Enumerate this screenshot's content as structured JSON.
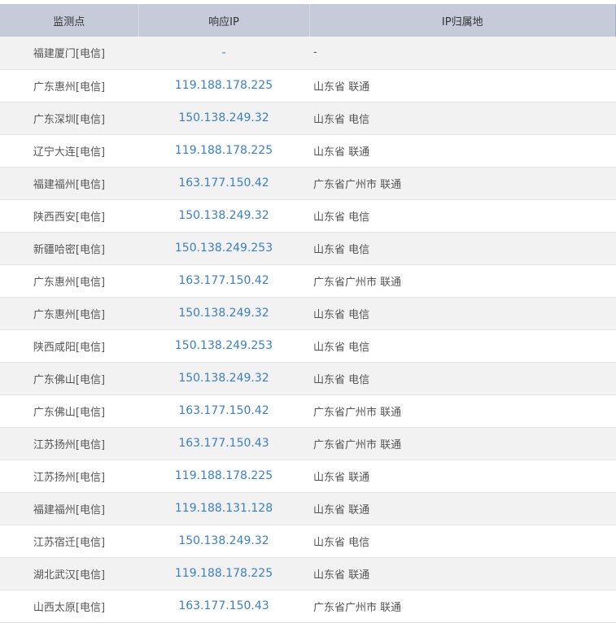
{
  "table": {
    "headers": [
      "监测点",
      "响应IP",
      "IP归属地"
    ],
    "rows": [
      {
        "point": "福建厦门[电信]",
        "ip": "-",
        "location": "-"
      },
      {
        "point": "广东惠州[电信]",
        "ip": "119.188.178.225",
        "location": "山东省 联通"
      },
      {
        "point": "广东深圳[电信]",
        "ip": "150.138.249.32",
        "location": "山东省 电信"
      },
      {
        "point": "辽宁大连[电信]",
        "ip": "119.188.178.225",
        "location": "山东省 联通"
      },
      {
        "point": "福建福州[电信]",
        "ip": "163.177.150.42",
        "location": "广东省广州市 联通"
      },
      {
        "point": "陕西西安[电信]",
        "ip": "150.138.249.32",
        "location": "山东省 电信"
      },
      {
        "point": "新疆哈密[电信]",
        "ip": "150.138.249.253",
        "location": "山东省 电信"
      },
      {
        "point": "广东惠州[电信]",
        "ip": "163.177.150.42",
        "location": "广东省广州市 联通"
      },
      {
        "point": "广东惠州[电信]",
        "ip": "150.138.249.32",
        "location": "山东省 电信"
      },
      {
        "point": "陕西咸阳[电信]",
        "ip": "150.138.249.253",
        "location": "山东省 电信"
      },
      {
        "point": "广东佛山[电信]",
        "ip": "150.138.249.32",
        "location": "山东省 电信"
      },
      {
        "point": "广东佛山[电信]",
        "ip": "163.177.150.42",
        "location": "广东省广州市 联通"
      },
      {
        "point": "江苏扬州[电信]",
        "ip": "163.177.150.43",
        "location": "广东省广州市 联通"
      },
      {
        "point": "江苏扬州[电信]",
        "ip": "119.188.178.225",
        "location": "山东省 联通"
      },
      {
        "point": "福建福州[电信]",
        "ip": "119.188.131.128",
        "location": "山东省 联通"
      },
      {
        "point": "江苏宿迁[电信]",
        "ip": "150.138.249.32",
        "location": "山东省 电信"
      },
      {
        "point": "湖北武汉[电信]",
        "ip": "119.188.178.225",
        "location": "山东省 联通"
      },
      {
        "point": "山西太原[电信]",
        "ip": "163.177.150.43",
        "location": "广东省广州市 联通"
      }
    ]
  }
}
